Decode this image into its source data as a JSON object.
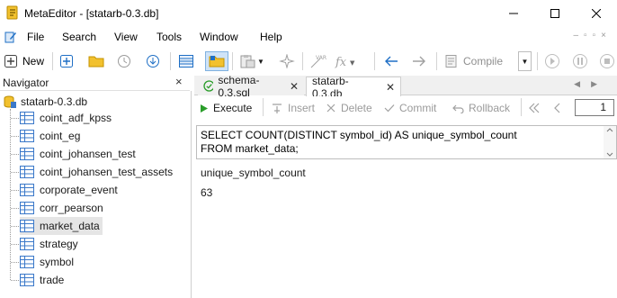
{
  "window": {
    "title": "MetaEditor - [statarb-0.3.db]"
  },
  "menu": {
    "items": [
      "File",
      "Search",
      "View",
      "Tools",
      "Window",
      "Help"
    ]
  },
  "toolbar": {
    "new_label": "New",
    "compile_label": "Compile"
  },
  "navigator": {
    "title": "Navigator",
    "close_glyph": "×",
    "root": "statarb-0.3.db",
    "tables": [
      "coint_adf_kpss",
      "coint_eg",
      "coint_johansen_test",
      "coint_johansen_test_assets",
      "corporate_event",
      "corr_pearson",
      "market_data",
      "strategy",
      "symbol",
      "trade"
    ],
    "selected": "market_data"
  },
  "tabs": [
    {
      "label": "schema-0.3.sql",
      "active": false
    },
    {
      "label": "statarb-0.3.db",
      "active": true
    }
  ],
  "exec_bar": {
    "execute": "Execute",
    "insert": "Insert",
    "delete": "Delete",
    "commit": "Commit",
    "rollback": "Rollback",
    "page": "1"
  },
  "sql": {
    "line1": "SELECT COUNT(DISTINCT symbol_id) AS unique_symbol_count",
    "line2": "FROM market_data;"
  },
  "result": {
    "column": "unique_symbol_count",
    "value": "63"
  },
  "colors": {
    "accent_blue": "#1f6fc5",
    "table_icon_blue": "#3a78c9",
    "folder_yellow": "#f2c12e",
    "execute_green": "#2a9d2a"
  }
}
